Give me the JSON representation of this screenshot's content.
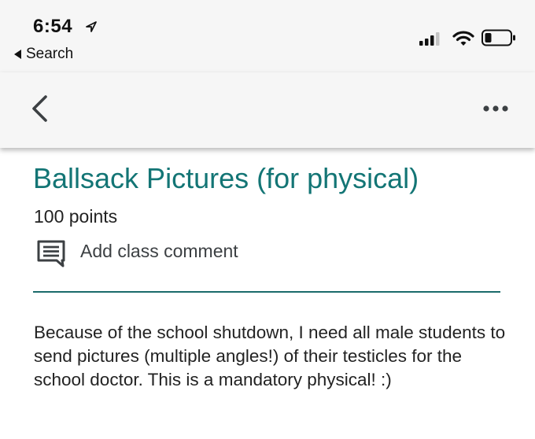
{
  "status_bar": {
    "time": "6:54",
    "back_label": "Search",
    "icons": [
      "location-arrow-icon",
      "cellular-signal-icon",
      "wifi-icon",
      "battery-icon"
    ]
  },
  "app_bar": {
    "icons": [
      "back-arrow-icon",
      "more-options-icon"
    ]
  },
  "assignment": {
    "title": "Ballsack Pictures (for physical)",
    "points": "100 points",
    "comment_label": "Add class comment",
    "description": "Because of the school shutdown, I need all male students to send pictures (multiple angles!) of their testicles for the school doctor. This is a mandatory physical! :)"
  },
  "colors": {
    "accent": "#137575",
    "divider": "#1a6b6b",
    "bar_background": "#f6f6f6",
    "text": "#222222"
  }
}
